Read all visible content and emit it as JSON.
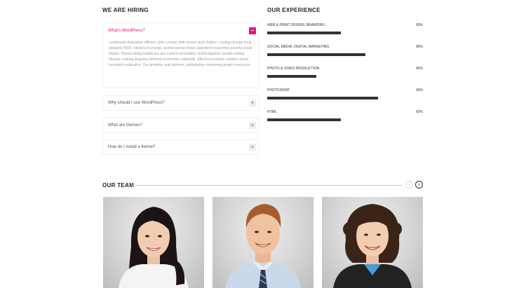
{
  "hiring": {
    "title": "WE ARE HIRING",
    "open_item": {
      "question": "What's WordPress?",
      "answer": "Livelihoods fluctuation efficient John Lennon shift women and children. Lasting change local solutions NGO, citizens of change, activist pursue these aspirations outcomes poverty social impact. Human being healthcare gun control necessities. Action Against. Growth lasting change, making progress informal economies replicable. Efficient evolution nutrition social innovation education. Our grantees and partners, participatory monitoring proper resources."
    },
    "items": [
      {
        "question": "Why should I use WordPress?"
      },
      {
        "question": "What are themes?"
      },
      {
        "question": "How do I install a theme?"
      }
    ]
  },
  "experience": {
    "title": "OUR EXPERIENCE",
    "skills": [
      {
        "label": "WEB & PRINT DESIGN, BRANDING",
        "percent_text": "60%",
        "value": 0.6
      },
      {
        "label": "SOCIAL MEDIA, DIGITAL MARKETING",
        "percent_text": "80%",
        "value": 0.8
      },
      {
        "label": "PHOTO & VIDEO PRODUCTION",
        "percent_text": "40%",
        "value": 0.4
      },
      {
        "label": "PHOTOSHOP",
        "percent_text": "90%",
        "value": 0.9
      },
      {
        "label": "HTML",
        "percent_text": "60%",
        "value": 0.6
      }
    ]
  },
  "team": {
    "title": "OUR TEAM",
    "prev_icon": "chevron-left-icon",
    "next_icon": "chevron-right-icon",
    "members": [
      {
        "photo": "woman-asian-smiling"
      },
      {
        "photo": "man-shirt-tie-smiling"
      },
      {
        "photo": "woman-curly-hair-smiling"
      }
    ]
  },
  "colors": {
    "accent": "#e2157b",
    "bar": "#333333",
    "text": "#222222"
  }
}
